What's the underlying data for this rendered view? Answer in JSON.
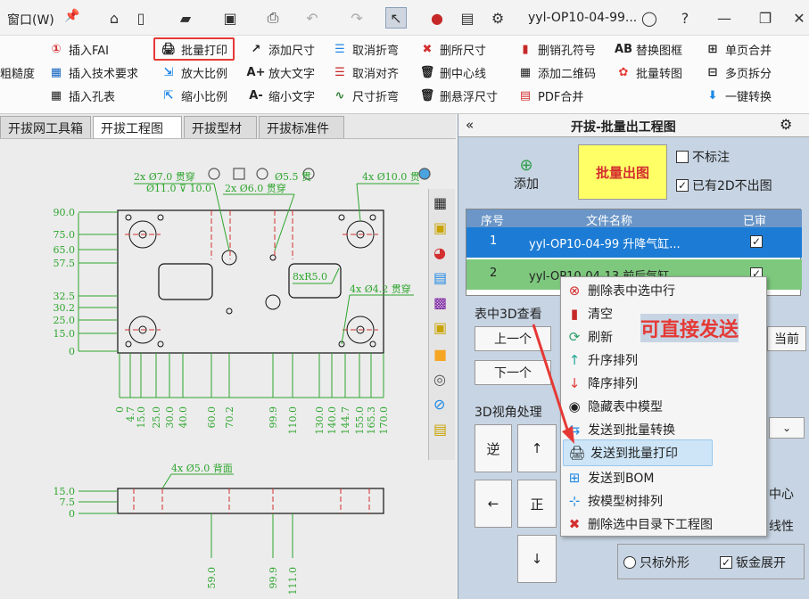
{
  "titlebar": {
    "menu_label": "窗口(W)",
    "doc_name": "yyl-OP10-04-99..."
  },
  "ribbon": {
    "col1": [
      "粗糙度"
    ],
    "col2": [
      "插入FAI",
      "插入技术要求",
      "插入孔表"
    ],
    "col3": [
      "批量打印",
      "放大比例",
      "缩小比例"
    ],
    "col4": [
      "添加尺寸",
      "放大文字",
      "缩小文字"
    ],
    "col5": [
      "取消折弯",
      "取消对齐",
      "尺寸折弯"
    ],
    "col6": [
      "删所尺寸",
      "删中心线",
      "删悬浮尺寸"
    ],
    "col7": [
      "删销孔符号",
      "添加二维码",
      "PDF合并"
    ],
    "col8": [
      "替换图框",
      "批量转图"
    ],
    "col9": [
      "单页合并",
      "多页拆分",
      "一键转换"
    ]
  },
  "tabs": [
    "开拔网工具箱",
    "开拔工程图",
    "开拔型材",
    "开拔标准件"
  ],
  "drawing": {
    "y_dims": [
      "90.0",
      "75.0",
      "65.0",
      "57.5",
      "32.5",
      "30.2",
      "25.0",
      "15.0",
      "0"
    ],
    "x_dims": [
      "0",
      "4.7",
      "15.0",
      "25.0",
      "30.0",
      "40.0",
      "60.0",
      "70.2",
      "99.9",
      "110.0",
      "130.0",
      "140.0",
      "144.7",
      "155.0",
      "165.3",
      "170.0"
    ],
    "notes": [
      "2x Ø7.0 贯穿",
      "Ø11.0 ⊽ 10.0",
      "2x Ø6.0 贯穿",
      "4x Ø10.0 贯",
      "8xR5.0",
      "4x Ø4.2 贯穿",
      "4x Ø5.0 背面",
      "Ø5.5 贯"
    ],
    "side_y_dims": [
      "15.0",
      "7.5",
      "0"
    ],
    "side_x_dims": [
      "59.0",
      "99.9",
      "111.0"
    ]
  },
  "panel": {
    "title": "开拔-批量出工程图",
    "add_label": "添加",
    "batch_label": "批量出图",
    "no_mark_label": "不标注",
    "has2d_label": "已有2D不出图",
    "no_mark_checked": false,
    "has2d_checked": true,
    "table_headers": [
      "序号",
      "文件名称",
      "已审"
    ],
    "rows": [
      {
        "no": "1",
        "name": "yyl-OP10-04-99 升降气缸...",
        "checked": true
      },
      {
        "no": "2",
        "name": "yyl-OP10-04-13 前后气缸...",
        "checked": true
      }
    ],
    "view3d_label": "表中3D查看",
    "prev_label": "上一个",
    "next_label": "下一个",
    "current_label": "当前",
    "angle_label": "3D视角处理",
    "rev_label": "逆",
    "front_label": "正",
    "up_arrow": "↑",
    "down_arrow": "↓",
    "left_arrow": "←",
    "center_label": "中心",
    "line_label": "线性",
    "outline_label": "只标外形",
    "sheet_label": "钣金展开",
    "sheet_checked": true
  },
  "context_menu": {
    "items": [
      {
        "label": "删除表中选中行",
        "icon": "⊗",
        "color": "#d32f2f"
      },
      {
        "label": "清空",
        "icon": "▮",
        "color": "#c62828"
      },
      {
        "label": "刷新",
        "icon": "⟳",
        "color": "#2e9e6b"
      },
      {
        "label": "升序排列",
        "icon": "↑",
        "color": "#26a69a"
      },
      {
        "label": "降序排列",
        "icon": "↓",
        "color": "#e53935"
      },
      {
        "label": "隐藏表中模型",
        "icon": "👁",
        "color": "#333333"
      },
      {
        "label": "发送到批量转换",
        "icon": "⇆",
        "color": "#1e88e5"
      },
      {
        "label": "发送到批量打印",
        "icon": "🖨",
        "color": "#333333"
      },
      {
        "label": "发送到BOM",
        "icon": "⊞",
        "color": "#1e88e5"
      },
      {
        "label": "按模型树排列",
        "icon": "⊹",
        "color": "#1e88e5"
      },
      {
        "label": "删除选中目录下工程图",
        "icon": "✖",
        "color": "#d32f2f"
      }
    ],
    "highlighted_index": 7
  },
  "annotation": {
    "text": "可直接发送",
    "color": "#e53935"
  }
}
